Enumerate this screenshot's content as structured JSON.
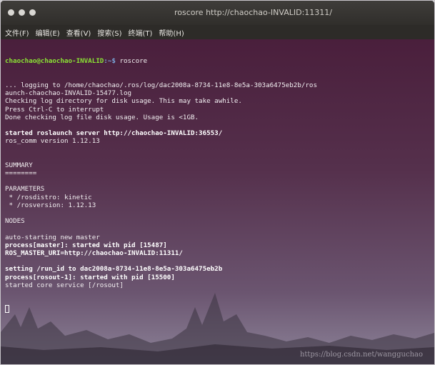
{
  "window": {
    "title": "roscore http://chaochao-INVALID:11311/"
  },
  "menu": {
    "items": [
      "文件(F)",
      "编辑(E)",
      "查看(V)",
      "搜索(S)",
      "终端(T)",
      "帮助(H)"
    ]
  },
  "terminal": {
    "prompt_user": "chaochao@chaochao-INVALID",
    "prompt_path": ":~$",
    "command": " roscore",
    "lines": [
      {
        "text": "... logging to /home/chaochao/.ros/log/dac2008a-8734-11e8-8e5a-303a6475eb2b/ros",
        "bold": false
      },
      {
        "text": "aunch-chaochao-INVALID-15477.log",
        "bold": false
      },
      {
        "text": "Checking log directory for disk usage. This may take awhile.",
        "bold": false
      },
      {
        "text": "Press Ctrl-C to interrupt",
        "bold": false
      },
      {
        "text": "Done checking log file disk usage. Usage is <1GB.",
        "bold": false
      },
      {
        "text": "",
        "bold": false
      },
      {
        "text": "started roslaunch server http://chaochao-INVALID:36553/",
        "bold": true
      },
      {
        "text": "ros_comm version 1.12.13",
        "bold": false
      },
      {
        "text": "",
        "bold": false
      },
      {
        "text": "",
        "bold": false
      },
      {
        "text": "SUMMARY",
        "bold": false
      },
      {
        "text": "========",
        "bold": false
      },
      {
        "text": "",
        "bold": false
      },
      {
        "text": "PARAMETERS",
        "bold": false
      },
      {
        "text": " * /rosdistro: kinetic",
        "bold": false
      },
      {
        "text": " * /rosversion: 1.12.13",
        "bold": false
      },
      {
        "text": "",
        "bold": false
      },
      {
        "text": "NODES",
        "bold": false
      },
      {
        "text": "",
        "bold": false
      },
      {
        "text": "auto-starting new master",
        "bold": false
      },
      {
        "text": "process[master]: started with pid [15487]",
        "bold": true
      },
      {
        "text": "ROS_MASTER_URI=http://chaochao-INVALID:11311/",
        "bold": true
      },
      {
        "text": "",
        "bold": false
      },
      {
        "text": "setting /run_id to dac2008a-8734-11e8-8e5a-303a6475eb2b",
        "bold": true
      },
      {
        "text": "process[rosout-1]: started with pid [15500]",
        "bold": true
      },
      {
        "text": "started core service [/rosout]",
        "bold": false
      }
    ],
    "watermark": "https://blog.csdn.net/wangguchao"
  },
  "colors": {
    "titlebar": "#302e2b",
    "terminal_bg_top": "#4a1f3c",
    "prompt_user": "#8ae234",
    "prompt_path": "#7aa6da"
  }
}
